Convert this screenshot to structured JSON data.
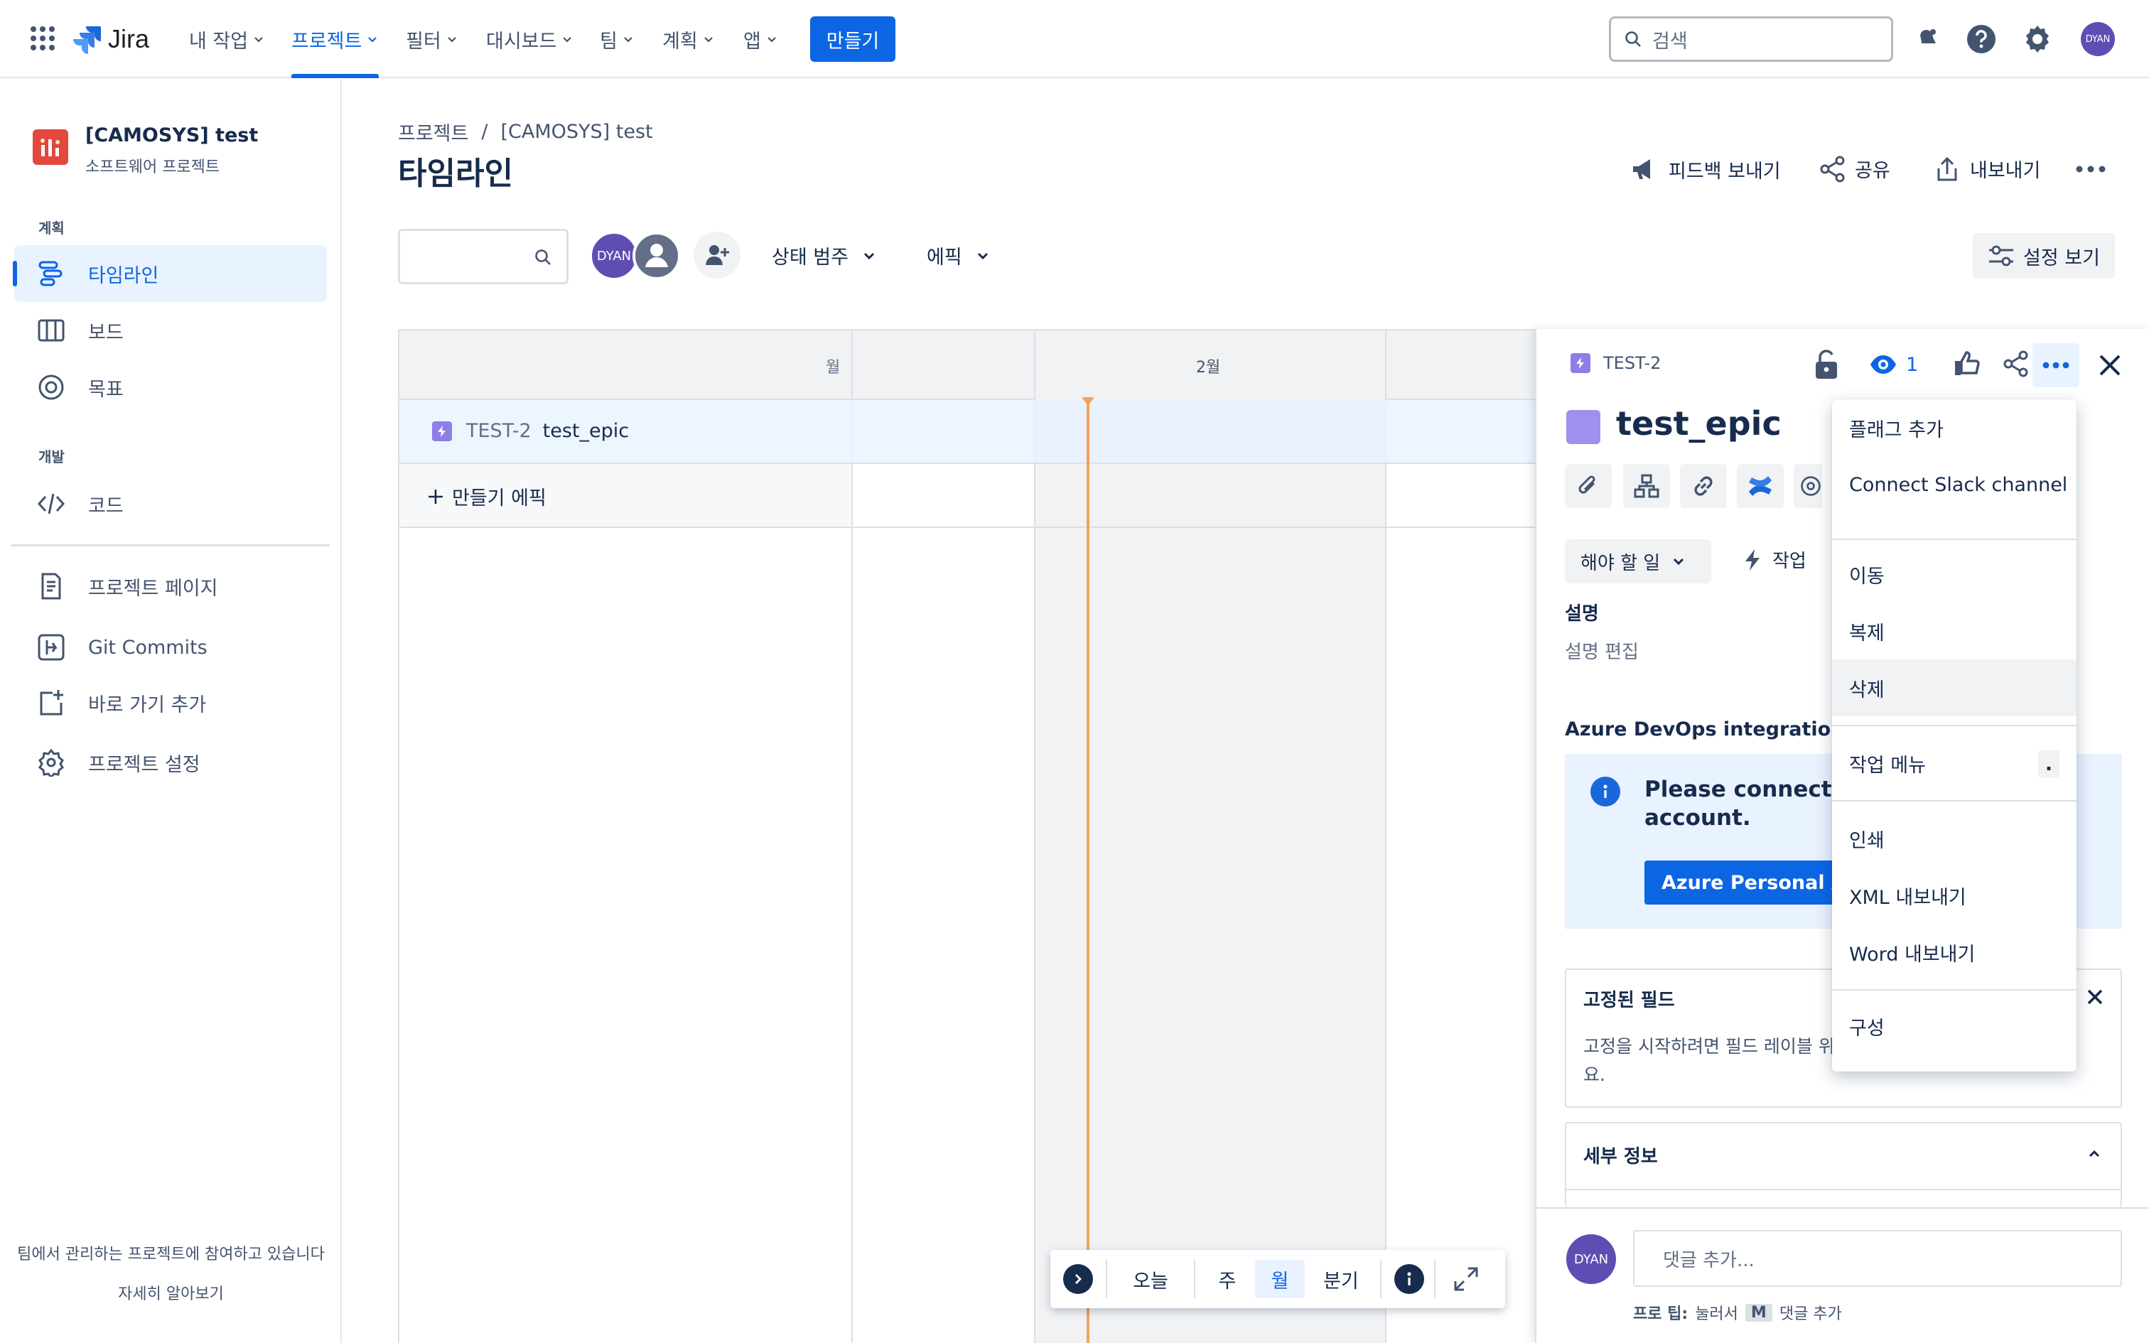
{
  "topnav": {
    "app_name": "Jira",
    "items": [
      {
        "label": "내 작업"
      },
      {
        "label": "프로젝트"
      },
      {
        "label": "필터"
      },
      {
        "label": "대시보드"
      },
      {
        "label": "팀"
      },
      {
        "label": "계획"
      },
      {
        "label": "앱"
      }
    ],
    "create_label": "만들기",
    "search_placeholder": "검색",
    "avatar_initials": "DYAN"
  },
  "sidebar": {
    "project_name": "[CAMOSYS] test",
    "project_type": "소프트웨어 프로젝트",
    "section_plan": "계획",
    "section_dev": "개발",
    "items": [
      {
        "label": "타임라인"
      },
      {
        "label": "보드"
      },
      {
        "label": "목표"
      },
      {
        "label": "코드"
      },
      {
        "label": "프로젝트 페이지"
      },
      {
        "label": "Git Commits"
      },
      {
        "label": "바로 가기 추가"
      },
      {
        "label": "프로젝트 설정"
      }
    ],
    "footer_text": "팀에서 관리하는 프로젝트에 참여하고 있습니다",
    "footer_link": "자세히 알아보기"
  },
  "main": {
    "breadcrumb_root": "프로젝트",
    "breadcrumb_sep": "/",
    "breadcrumb_project": "[CAMOSYS] test",
    "title": "타임라인",
    "actions": {
      "feedback": "피드백 보내기",
      "share": "공유",
      "export": "내보내기"
    },
    "avatar_initials": "DYAN",
    "filter_status": "상태 범주",
    "filter_epic": "에픽",
    "view_settings": "설정 보기"
  },
  "timeline": {
    "month_partial": "월",
    "month_label": "2월",
    "row_key": "TEST-2",
    "row_summary": "test_epic",
    "create_epic": "만들기 에픽",
    "controls": {
      "today": "오늘",
      "week": "주",
      "month": "월",
      "quarter": "분기"
    }
  },
  "panel": {
    "issue_key": "TEST-2",
    "watch_count": "1",
    "title": "test_epic",
    "status": "해야 할 일",
    "action_label": "작업",
    "description_label": "설명",
    "description_placeholder": "설명 편집",
    "azure_heading": "Azure DevOps integration fo",
    "azure_message_line1": "Please connect yo",
    "azure_message_line2": "account.",
    "azure_button": "Azure Personal Ac",
    "pinned_title": "고정된 필드",
    "pinned_text_line1": "고정을 시작하려면 필드 레이블 위",
    "pinned_text_line2": "요.",
    "details_title": "세부 정보",
    "comment_avatar": "DYAN",
    "comment_placeholder": "댓글 추가...",
    "tip_prefix": "프로 팁:",
    "tip_press": "눌러서",
    "tip_key": "M",
    "tip_suffix": "댓글 추가"
  },
  "menu": {
    "items": [
      {
        "label": "플래그 추가"
      },
      {
        "label": "Connect Slack channel"
      },
      {
        "label": "이동"
      },
      {
        "label": "복제"
      },
      {
        "label": "삭제"
      },
      {
        "label": "작업 메뉴"
      },
      {
        "label": "인쇄"
      },
      {
        "label": "XML 내보내기"
      },
      {
        "label": "Word 내보내기"
      },
      {
        "label": "구성"
      }
    ],
    "shortcut": "."
  },
  "colors": {
    "brand_blue": "#0c66e4",
    "epic_purple": "#8f7ee7",
    "today_line": "#f5a15b",
    "project_icon": "#e2483d"
  }
}
